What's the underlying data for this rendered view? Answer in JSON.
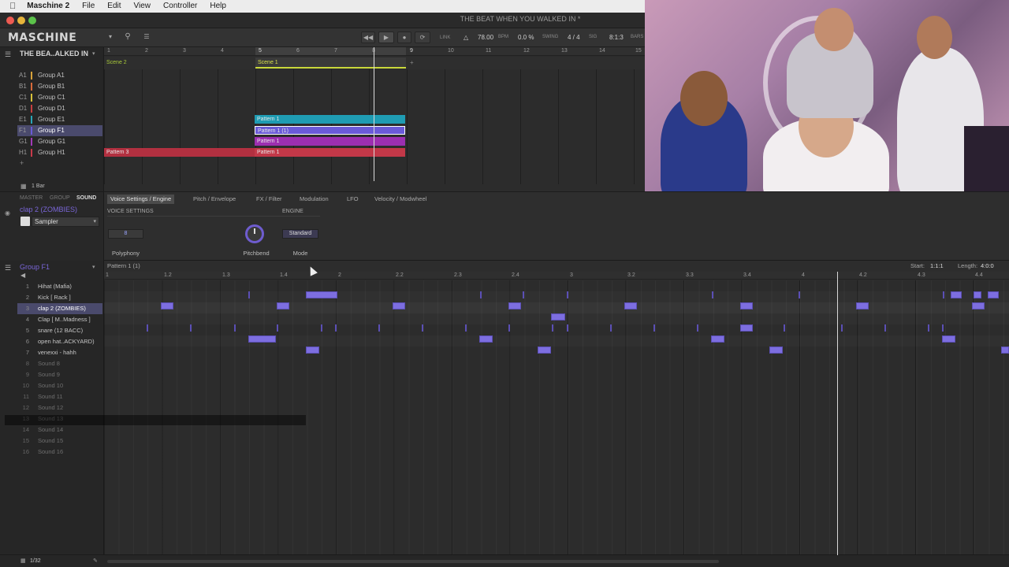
{
  "menubar": {
    "app": "Maschine 2",
    "items": [
      "File",
      "Edit",
      "View",
      "Controller",
      "Help"
    ]
  },
  "window": {
    "title": "THE BEAT WHEN YOU WALKED IN *"
  },
  "toolbar": {
    "logo": "MASCHINE",
    "link": "LINK",
    "tempo": "78.00",
    "tempo_unit": "BPM",
    "swing": "0.0 %",
    "swing_label": "SWING",
    "signature": "4 / 4",
    "sig_label": "SIG",
    "position": "8:1:3",
    "position_label": "BARS"
  },
  "arranger": {
    "project_title": "THE BEA..ALKED IN",
    "ruler": [
      "1",
      "2",
      "3",
      "4",
      "5",
      "6",
      "7",
      "8",
      "9",
      "10",
      "11",
      "12",
      "13",
      "14",
      "15"
    ],
    "scenes": [
      {
        "label": "Scene 2",
        "color": "#a8c93a"
      },
      {
        "label": "Scene 1",
        "color": "#c9d83a"
      }
    ],
    "groups": [
      {
        "id": "A1",
        "name": "Group A1",
        "color": "#d8a23a"
      },
      {
        "id": "B1",
        "name": "Group B1",
        "color": "#d86a3a"
      },
      {
        "id": "C1",
        "name": "Group C1",
        "color": "#d8c23a"
      },
      {
        "id": "D1",
        "name": "Group D1",
        "color": "#c84040"
      },
      {
        "id": "E1",
        "name": "Group E1",
        "color": "#2aa6b8"
      },
      {
        "id": "F1",
        "name": "Group F1",
        "color": "#6a5ad8"
      },
      {
        "id": "G1",
        "name": "Group G1",
        "color": "#a23ab8"
      },
      {
        "id": "H1",
        "name": "Group H1",
        "color": "#c83a4a"
      }
    ],
    "patterns": {
      "e1": "Pattern 1",
      "f1": "Pattern 1 (1)",
      "g1": "Pattern 1",
      "h1_left": "Pattern 3",
      "h1_right": "Pattern 1"
    },
    "bar_length": "1 Bar",
    "add_symbol": "+"
  },
  "sound_panel": {
    "tabs": [
      "MASTER",
      "GROUP",
      "SOUND"
    ],
    "active_tab": "SOUND",
    "sound_name": "clap 2 (ZOMBIES)",
    "plugin": "Sampler",
    "param_tabs": [
      "Voice Settings / Engine",
      "Pitch / Envelope",
      "FX / Filter",
      "Modulation",
      "LFO",
      "Velocity / Modwheel"
    ],
    "sections": {
      "voice": "VOICE SETTINGS",
      "engine": "ENGINE"
    },
    "polyphony": {
      "value": "8",
      "label": "Polyphony"
    },
    "pitchbend": {
      "label": "Pitchbend"
    },
    "mode": {
      "value": "Standard",
      "label": "Mode"
    }
  },
  "pattern_editor": {
    "group": "Group F1",
    "pattern": "Pattern 1 (1)",
    "start_label": "Start:",
    "start": "1:1:1",
    "length_label": "Length:",
    "length": "4:0:0",
    "ruler": [
      "1",
      "1.2",
      "1.3",
      "1.4",
      "2",
      "2.2",
      "2.3",
      "2.4",
      "3",
      "3.2",
      "3.3",
      "3.4",
      "4",
      "4.2",
      "4.3",
      "4.4"
    ],
    "sounds": [
      {
        "n": "1",
        "name": "Hihat (Mafia)"
      },
      {
        "n": "2",
        "name": "Kick [ Rack ]"
      },
      {
        "n": "3",
        "name": "clap 2 (ZOMBIES)"
      },
      {
        "n": "4",
        "name": "Clap [ M..Madness ]"
      },
      {
        "n": "5",
        "name": "snare (12 BACC)"
      },
      {
        "n": "6",
        "name": "open hat..ACKYARD)"
      },
      {
        "n": "7",
        "name": "venexxi - hahh"
      },
      {
        "n": "8",
        "name": "Sound 8"
      },
      {
        "n": "9",
        "name": "Sound 9"
      },
      {
        "n": "10",
        "name": "Sound 10"
      },
      {
        "n": "11",
        "name": "Sound 11"
      },
      {
        "n": "12",
        "name": "Sound 12"
      },
      {
        "n": "13",
        "name": "Sound 13"
      },
      {
        "n": "14",
        "name": "Sound 14"
      },
      {
        "n": "15",
        "name": "Sound 15"
      },
      {
        "n": "16",
        "name": "Sound 16"
      }
    ],
    "selected_sound": 3,
    "grid_resolution": "1/32"
  },
  "colors": {
    "accent": "#7d6ee0",
    "note": "#7d6ee0",
    "selection": "#4a4a6c"
  }
}
